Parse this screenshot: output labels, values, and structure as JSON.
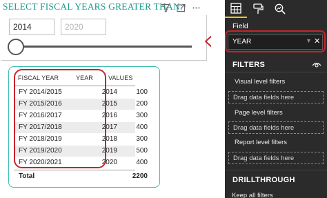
{
  "slicer": {
    "title": "SELECT FISCAL YEARS GREATER THAN:",
    "min_value": "2014",
    "max_value": "2020",
    "slider_position": 0.0
  },
  "table": {
    "headers": [
      "FISCAL YEAR",
      "YEAR",
      "VALUES"
    ],
    "rows": [
      {
        "fiscal_year": "FY 2014/2015",
        "year": "2014",
        "value": "100"
      },
      {
        "fiscal_year": "FY 2015/2016",
        "year": "2015",
        "value": "200"
      },
      {
        "fiscal_year": "FY 2016/2017",
        "year": "2016",
        "value": "300"
      },
      {
        "fiscal_year": "FY 2017/2018",
        "year": "2017",
        "value": "400"
      },
      {
        "fiscal_year": "FY 2018/2019",
        "year": "2018",
        "value": "300"
      },
      {
        "fiscal_year": "FY 2019/2020",
        "year": "2019",
        "value": "500"
      },
      {
        "fiscal_year": "FY 2020/2021",
        "year": "2020",
        "value": "400"
      }
    ],
    "total_label": "Total",
    "total_value": "2200"
  },
  "panel": {
    "tabs": [
      "fields-icon",
      "format-paint-icon",
      "analytics-icon"
    ],
    "field_label": "Field",
    "field_value": "YEAR",
    "filters_title": "FILTERS",
    "visual_level": "Visual level filters",
    "page_level": "Page level filters",
    "report_level": "Report level filters",
    "drag_placeholder": "Drag data fields here",
    "drillthrough_title": "DRILLTHROUGH",
    "keep_filters": "Keep all filters"
  },
  "colors": {
    "title_teal": "#1a9a8e",
    "highlight_red": "#c8232b",
    "panel_dark": "#2b2b2b",
    "accent_yellow": "#f2c811"
  }
}
